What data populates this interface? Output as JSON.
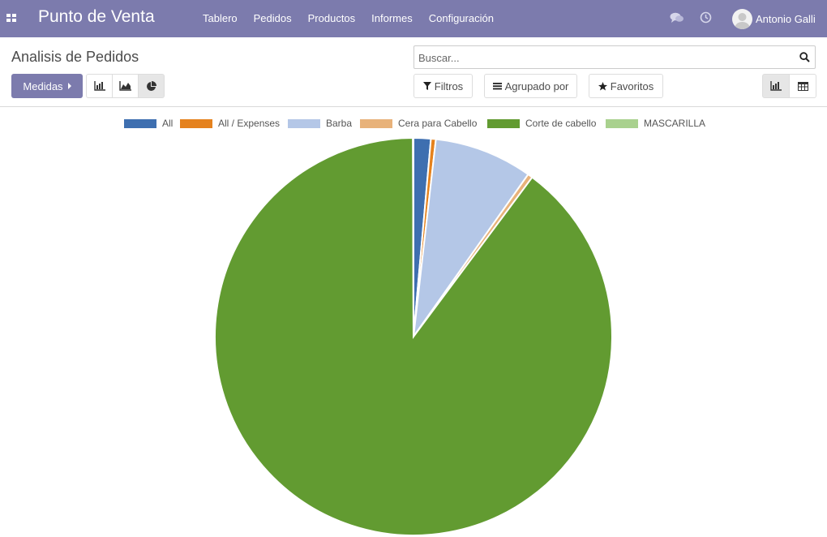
{
  "navbar": {
    "brand": "Punto de Venta",
    "menu": [
      "Tablero",
      "Pedidos",
      "Productos",
      "Informes",
      "Configuración"
    ],
    "user_name": "Antonio Galli",
    "icons": [
      "apps-icon",
      "chat-icon",
      "clock-icon"
    ]
  },
  "control_panel": {
    "title": "Analisis de Pedidos",
    "measures_label": "Medidas",
    "search_placeholder": "Buscar...",
    "filters_label": "Filtros",
    "group_by_label": "Agrupado por",
    "favorites_label": "Favoritos",
    "active_chart_mode": "pie",
    "active_view": "graph"
  },
  "chart_data": {
    "type": "pie",
    "legend_position": "top",
    "categories": [
      "All",
      "All / Expenses",
      "Barba",
      "Cera para Cabello",
      "Corte de cabello",
      "MASCARILLA"
    ],
    "values": [
      1.4,
      0.4,
      8.0,
      0.4,
      89.8,
      0.05
    ],
    "colors": [
      "#3e6fb0",
      "#e5821e",
      "#b4c7e7",
      "#e8b27a",
      "#629b31",
      "#a9d18e"
    ]
  }
}
